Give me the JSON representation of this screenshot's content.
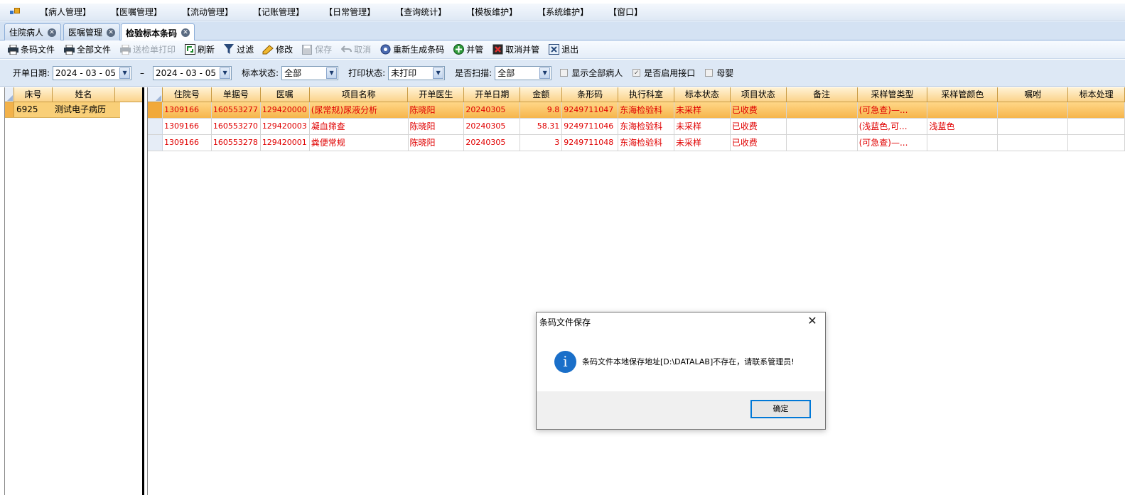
{
  "menu": {
    "items": [
      "【病人管理】",
      "【医嘱管理】",
      "【流动管理】",
      "【记账管理】",
      "【日常管理】",
      "【查询统计】",
      "【模板维护】",
      "【系统维护】",
      "【窗口】"
    ]
  },
  "tabs": [
    {
      "label": "住院病人",
      "active": false
    },
    {
      "label": "医嘱管理",
      "active": false
    },
    {
      "label": "检验标本条码",
      "active": true
    }
  ],
  "toolbar": {
    "buttons": [
      {
        "label": "条码文件",
        "icon": "printer-icon",
        "enabled": true
      },
      {
        "label": "全部文件",
        "icon": "printer-icon",
        "enabled": true
      },
      {
        "label": "送检单打印",
        "icon": "printer-icon",
        "enabled": false
      },
      {
        "label": "刷新",
        "icon": "refresh-icon",
        "enabled": true
      },
      {
        "label": "过滤",
        "icon": "filter-icon",
        "enabled": true
      },
      {
        "label": "修改",
        "icon": "edit-icon",
        "enabled": true
      },
      {
        "label": "保存",
        "icon": "save-icon",
        "enabled": false
      },
      {
        "label": "取消",
        "icon": "undo-icon",
        "enabled": false
      },
      {
        "label": "重新生成条码",
        "icon": "gear-icon",
        "enabled": true
      },
      {
        "label": "并管",
        "icon": "add-icon",
        "enabled": true
      },
      {
        "label": "取消并管",
        "icon": "cancel-icon",
        "enabled": true
      },
      {
        "label": "退出",
        "icon": "exit-icon",
        "enabled": true
      }
    ]
  },
  "filters": {
    "start_date_label": "开单日期:",
    "date_from": "2024 - 03 - 05",
    "date_sep": "–",
    "date_to": "2024 - 03 - 05",
    "specimen_status_label": "标本状态:",
    "specimen_status_value": "全部",
    "print_status_label": "打印状态:",
    "print_status_value": "未打印",
    "scanned_label": "是否扫描:",
    "scanned_value": "全部",
    "show_all_patients_label": "显示全部病人",
    "show_all_patients_checked": false,
    "enable_interface_label": "是否启用接口",
    "enable_interface_checked": true,
    "mother_baby_label": "母婴",
    "mother_baby_checked": false
  },
  "patient_grid": {
    "columns": [
      "床号",
      "姓名"
    ],
    "rows": [
      {
        "bed": "6925",
        "name": "测试电子病历"
      }
    ]
  },
  "order_grid": {
    "columns": [
      "住院号",
      "单据号",
      "医嘱",
      "项目名称",
      "开单医生",
      "开单日期",
      "金额",
      "条形码",
      "执行科室",
      "标本状态",
      "项目状态",
      "备注",
      "采样管类型",
      "采样管颜色",
      "嘱咐",
      "标本处理"
    ],
    "rows": [
      {
        "inpatient_no": "1309166",
        "bill_no": "160553277",
        "order": "129420000",
        "item": "(尿常规)尿液分析",
        "doctor": "陈晓阳",
        "date": "20240305",
        "amount": "9.8",
        "barcode": "9249711047",
        "dept": "东海检验科",
        "specimen_status": "未采样",
        "item_status": "已收费",
        "note": "",
        "tube_type": "(可急查)—...",
        "tube_color": "",
        "advice": "",
        "processing": ""
      },
      {
        "inpatient_no": "1309166",
        "bill_no": "160553270",
        "order": "129420003",
        "item": "凝血筛查",
        "doctor": "陈晓阳",
        "date": "20240305",
        "amount": "58.31",
        "barcode": "9249711046",
        "dept": "东海检验科",
        "specimen_status": "未采样",
        "item_status": "已收费",
        "note": "",
        "tube_type": "(浅蓝色,可...",
        "tube_color": "浅蓝色",
        "advice": "",
        "processing": ""
      },
      {
        "inpatient_no": "1309166",
        "bill_no": "160553278",
        "order": "129420001",
        "item": "粪便常规",
        "doctor": "陈晓阳",
        "date": "20240305",
        "amount": "3",
        "barcode": "9249711048",
        "dept": "东海检验科",
        "specimen_status": "未采样",
        "item_status": "已收费",
        "note": "",
        "tube_type": "(可急查)—...",
        "tube_color": "",
        "advice": "",
        "processing": ""
      }
    ]
  },
  "dialog": {
    "title": "条码文件保存",
    "message": "条码文件本地保存地址[D:\\DATALAB]不存在，请联系管理员!",
    "ok_label": "确定",
    "close_glyph": "✕",
    "info_glyph": "i"
  }
}
